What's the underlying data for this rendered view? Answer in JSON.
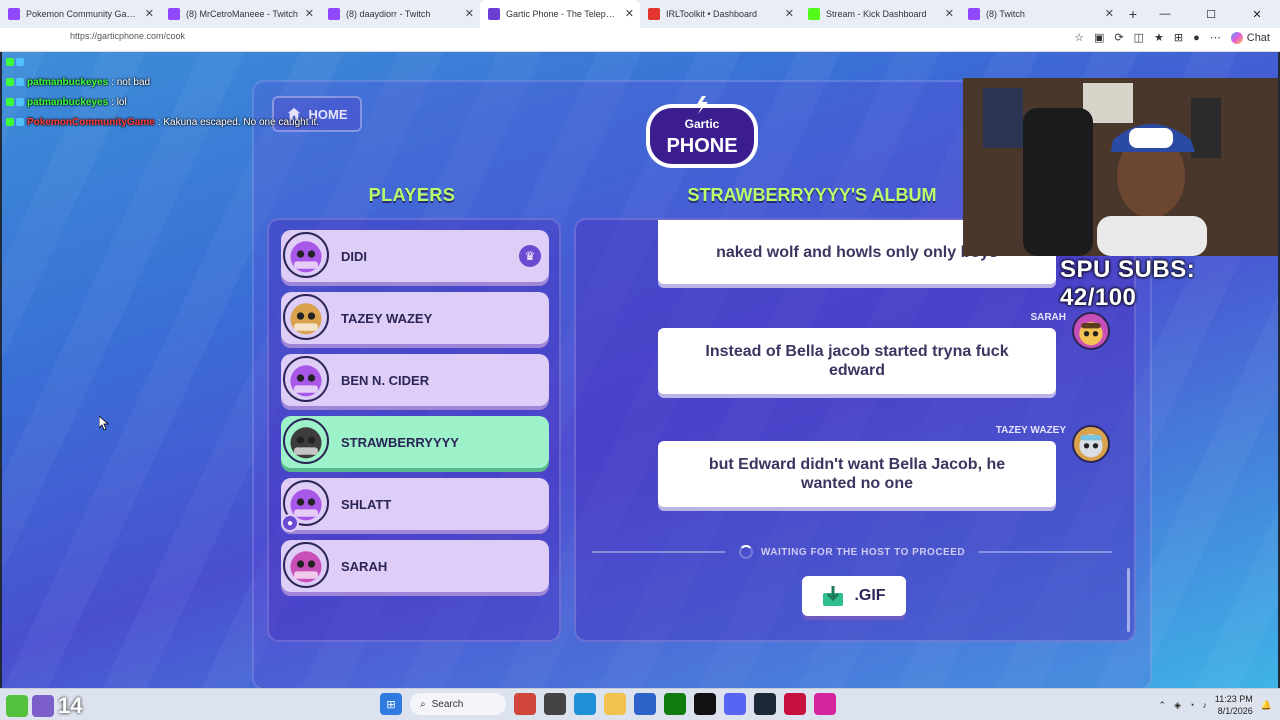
{
  "browser": {
    "tabs": [
      {
        "label": "Pokemon Community Game",
        "color": "#9146ff",
        "active": false
      },
      {
        "label": "(8) MrCetroManeee - Twitch",
        "color": "#9146ff",
        "active": false
      },
      {
        "label": "(8) daaydiorr - Twitch",
        "color": "#9146ff",
        "active": false
      },
      {
        "label": "Gartic Phone - The Telephone Game",
        "color": "#6b3fd6",
        "active": true
      },
      {
        "label": "IRLToolkit • Dashboard",
        "color": "#e3342f",
        "active": false
      },
      {
        "label": "Stream - Kick Dashboard",
        "color": "#53fc18",
        "active": false
      },
      {
        "label": "(8) Twitch",
        "color": "#9146ff",
        "active": false
      }
    ],
    "url": "https://garticphone.com/cook",
    "chat_label": "Chat"
  },
  "chat_overlay": [
    {
      "user": "",
      "message": "",
      "user_style": "user2"
    },
    {
      "user": "patmanbuckeyes",
      "message": ": not bad",
      "user_style": "user2"
    },
    {
      "user": "patmanbuckeyes",
      "message": ": lol",
      "user_style": "user2"
    },
    {
      "user": "PokemonCommunityGame",
      "message": ": Kakuna escaped. No one caught it.",
      "user_style": "user1"
    }
  ],
  "game": {
    "home_label": "HOME",
    "logo_top": "Gartic",
    "logo_bottom": "PHONE",
    "players_title": "PLAYERS",
    "album_title": "STRAWBERRYYYY'S ALBUM",
    "players": [
      {
        "name": "DIDI",
        "avatar_color": "#a857e8",
        "host": true
      },
      {
        "name": "TAZEY WAZEY",
        "avatar_color": "#d9a24b"
      },
      {
        "name": "BEN N. CIDER",
        "avatar_color": "#a857e8"
      },
      {
        "name": "STRAWBERRYYYY",
        "avatar_color": "#3d3d3d",
        "highlight": true
      },
      {
        "name": "SHLATT",
        "avatar_color": "#a857e8",
        "sub": true
      },
      {
        "name": "SARAH",
        "avatar_color": "#c94fb8"
      }
    ],
    "messages": [
      {
        "author": "",
        "text": "naked wolf and howls only only boys"
      },
      {
        "author": "SARAH",
        "text": "Instead of Bella jacob started tryna fuck edward"
      },
      {
        "author": "TAZEY WAZEY",
        "text": "but Edward didn't want Bella Jacob, he wanted no one"
      }
    ],
    "waiting_label": "WAITING FOR THE HOST TO PROCEED",
    "gif_label": ".GIF"
  },
  "stream": {
    "subs_label": "SPU SUBS: 42/100"
  },
  "taskbar": {
    "overlay_number": "14",
    "search_label": "Search",
    "time": "11:23 PM",
    "date": "8/1/2026"
  }
}
